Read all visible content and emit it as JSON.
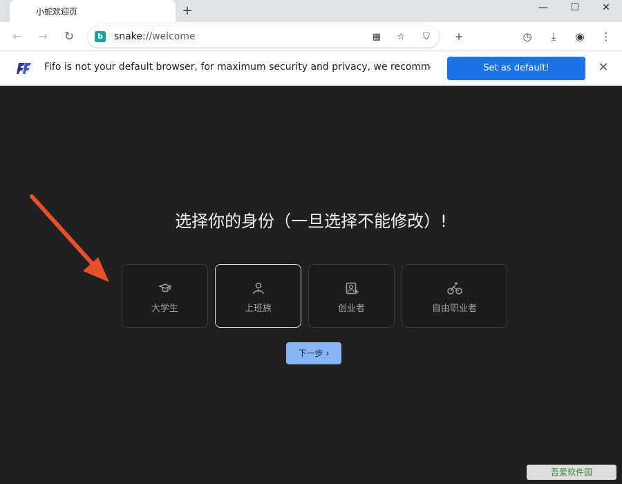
{
  "tab": {
    "title": "小蛇欢迎页"
  },
  "toolbar": {
    "url_scheme": "snake:",
    "url_path": "//welcome"
  },
  "infobar": {
    "message": "Fifo is not your default browser, for maximum security and privacy, we recommen...",
    "button_label": "Set as default!"
  },
  "main": {
    "heading": "选择你的身份（一旦选择不能修改）!",
    "cards": [
      {
        "label": "大学生",
        "icon": "graduation-cap-icon",
        "selected": false
      },
      {
        "label": "上班族",
        "icon": "person-icon",
        "selected": true
      },
      {
        "label": "创业者",
        "icon": "person-card-icon",
        "selected": false
      },
      {
        "label": "自由职业者",
        "icon": "bicycle-icon",
        "selected": false
      }
    ],
    "next_label": "下一步"
  },
  "watermark": {
    "text": "吾爱软件园"
  },
  "colors": {
    "accent": "#1a73e8",
    "next_button": "#8ab4f8",
    "arrow": "#e8502c",
    "content_bg": "#202020"
  }
}
